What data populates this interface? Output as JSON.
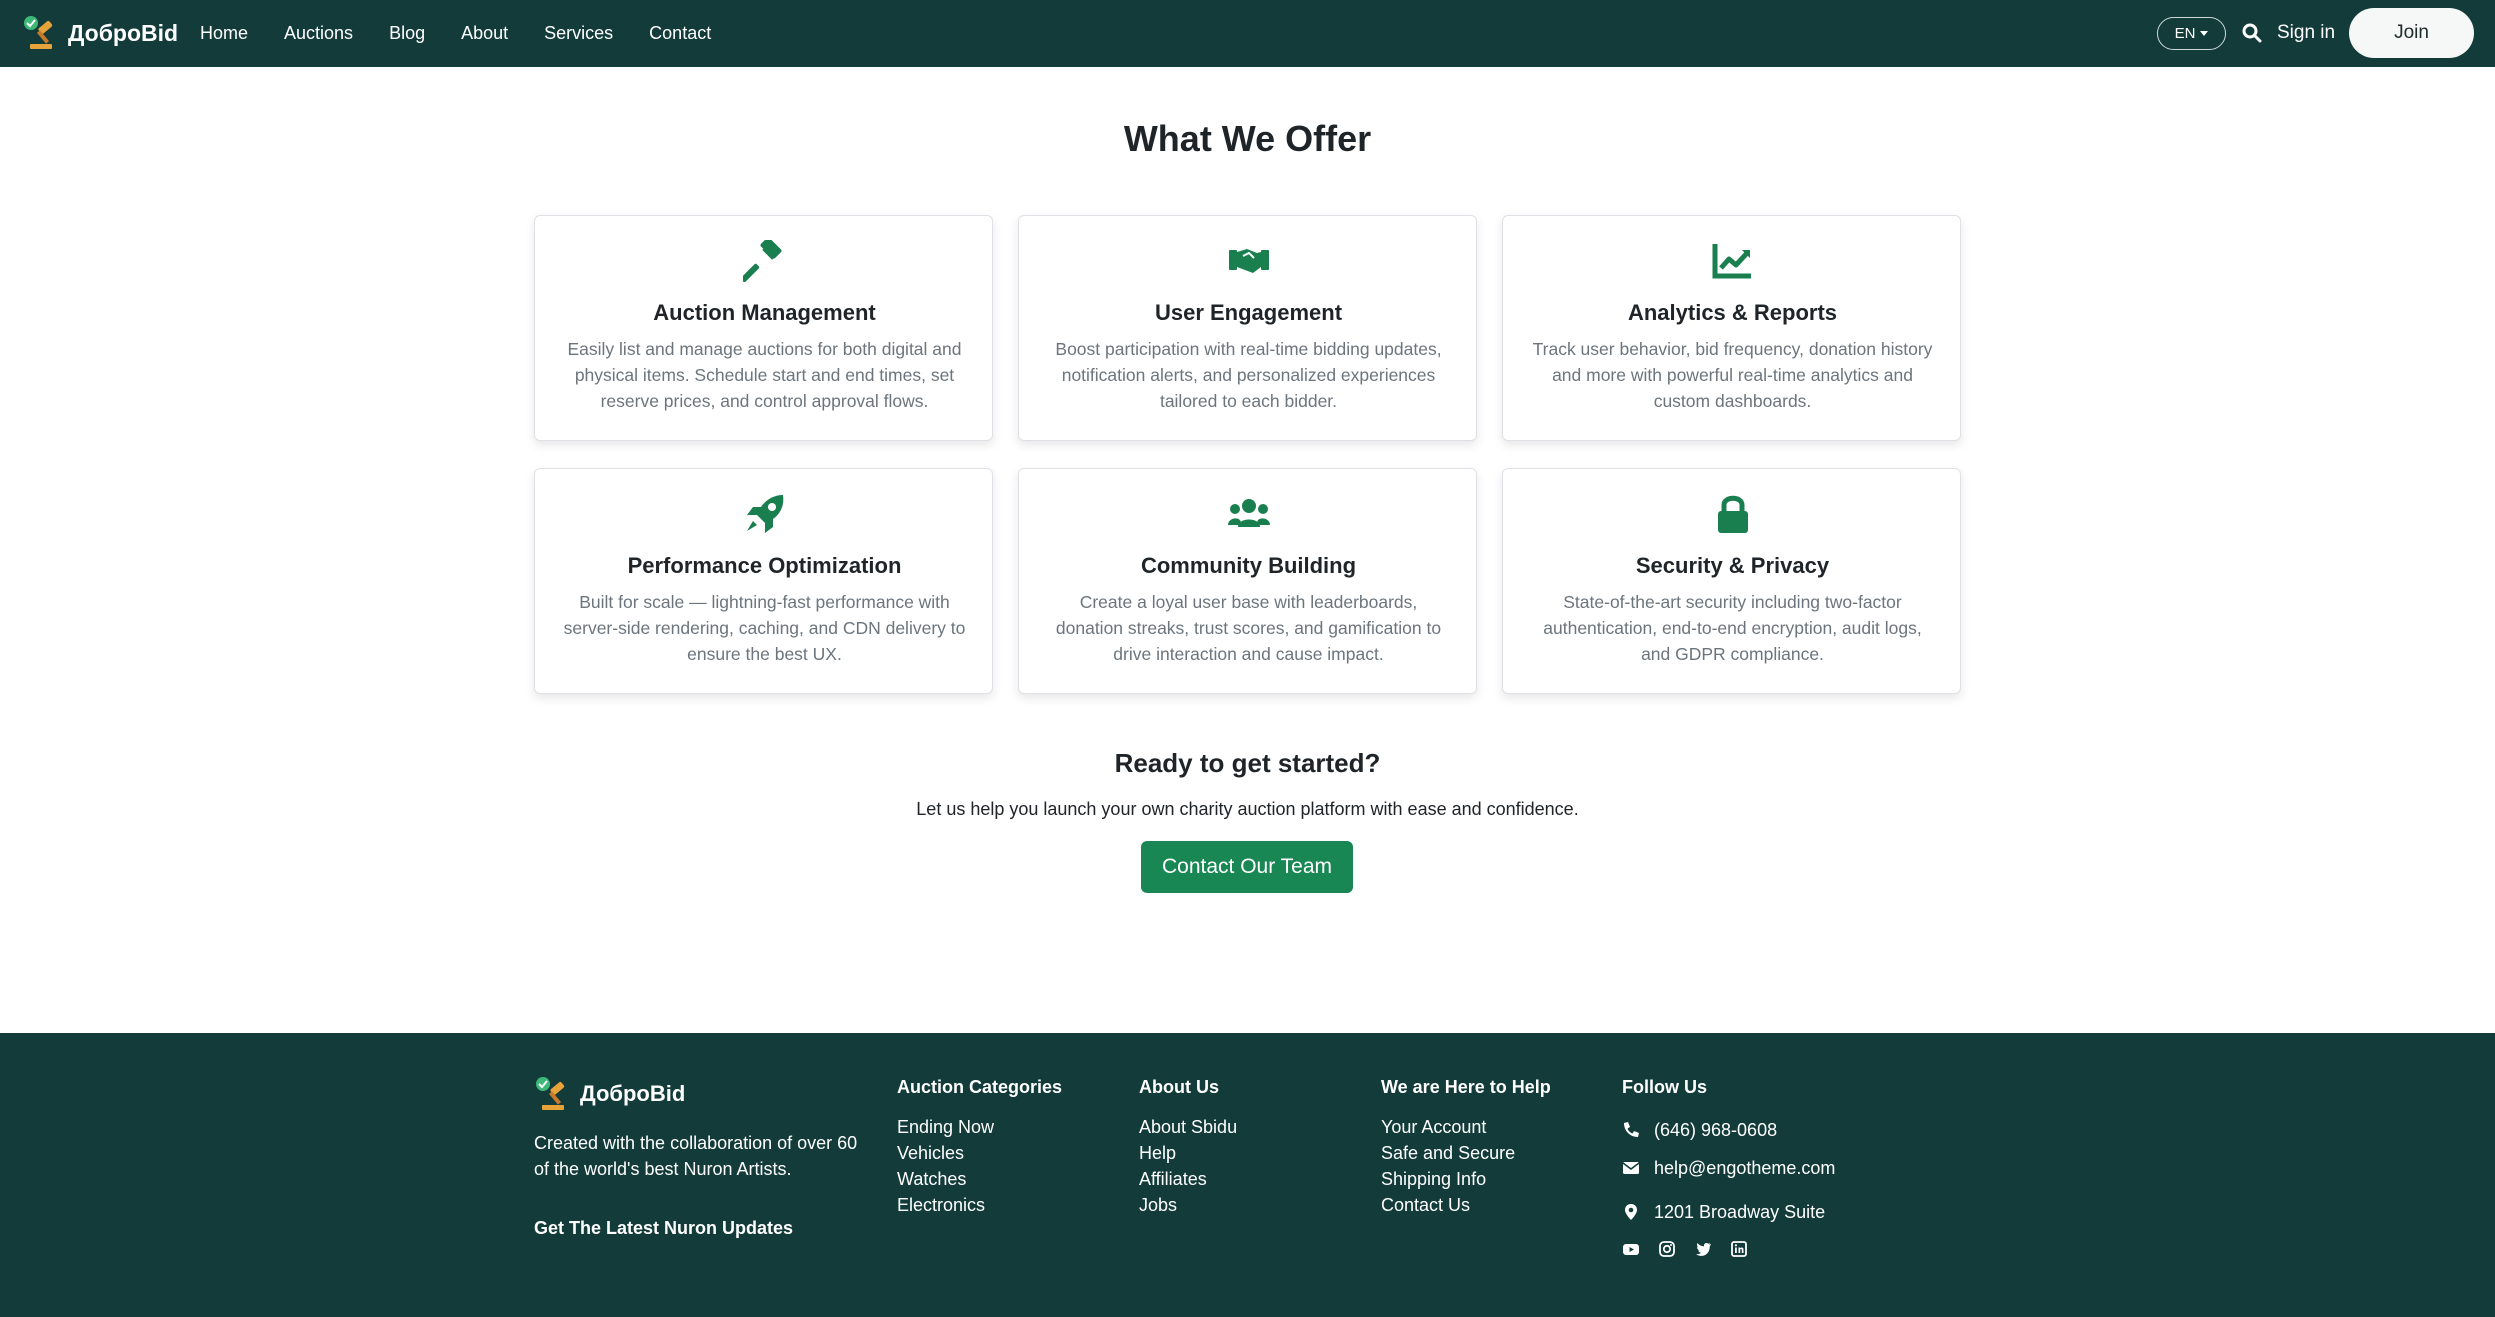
{
  "nav": {
    "brand": "ДоброBid",
    "links": [
      "Home",
      "Auctions",
      "Blog",
      "About",
      "Services",
      "Contact"
    ],
    "lang": "EN",
    "signin": "Sign in",
    "join": "Join"
  },
  "offer": {
    "title": "What We Offer",
    "cards": [
      {
        "icon": "gavel-icon",
        "title": "Auction Management",
        "text": "Easily list and manage auctions for both digital and physical items. Schedule start and end times, set reserve prices, and control approval flows."
      },
      {
        "icon": "handshake-icon",
        "title": "User Engagement",
        "text": "Boost participation with real-time bidding updates, notification alerts, and personalized experiences tailored to each bidder."
      },
      {
        "icon": "chart-line-icon",
        "title": "Analytics & Reports",
        "text": "Track user behavior, bid frequency, donation history and more with powerful real-time analytics and custom dashboards."
      },
      {
        "icon": "rocket-icon",
        "title": "Performance Optimization",
        "text": "Built for scale — lightning-fast performance with server-side rendering, caching, and CDN delivery to ensure the best UX."
      },
      {
        "icon": "users-icon",
        "title": "Community Building",
        "text": "Create a loyal user base with leaderboards, donation streaks, trust scores, and gamification to drive interaction and cause impact."
      },
      {
        "icon": "lock-icon",
        "title": "Security & Privacy",
        "text": "State-of-the-art security including two-factor authentication, end-to-end encryption, audit logs, and GDPR compliance."
      }
    ]
  },
  "cta": {
    "title": "Ready to get started?",
    "text": "Let us help you launch your own charity auction platform with ease and confidence.",
    "button": "Contact Our Team"
  },
  "footer": {
    "brand": "ДоброBid",
    "description": "Created with the collaboration of over 60 of the world's best Nuron Artists.",
    "updates": "Get The Latest Nuron Updates",
    "columns": [
      {
        "title": "Auction Categories",
        "items": [
          "Ending Now",
          "Vehicles",
          "Watches",
          "Electronics"
        ]
      },
      {
        "title": "About Us",
        "items": [
          "About Sbidu",
          "Help",
          "Affiliates",
          "Jobs"
        ]
      },
      {
        "title": "We are Here to Help",
        "items": [
          "Your Account",
          "Safe and Secure",
          "Shipping Info",
          "Contact Us"
        ]
      }
    ],
    "follow": {
      "title": "Follow Us",
      "phone": "(646) 968-0608",
      "email": "help@engotheme.com",
      "address": "1201 Broadway Suite"
    }
  },
  "colors": {
    "nav_bg": "#123b3a",
    "accent": "#198754",
    "icon_green": "#1a7f4f"
  }
}
